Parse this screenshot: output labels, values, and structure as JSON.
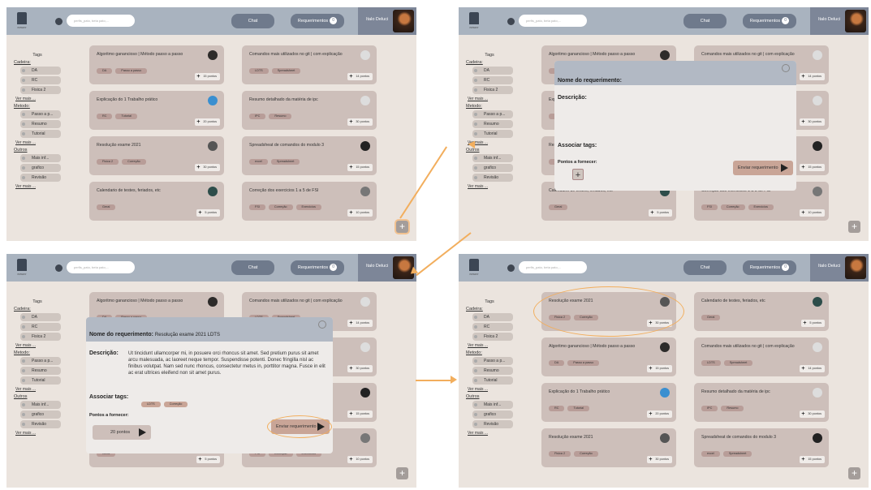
{
  "header": {
    "logo_text": "ISTUDY",
    "search_placeholder": "perfis_pato, beta pato,...",
    "chat": "Chat",
    "requests": "Requerimentos",
    "request_count": "0",
    "user_name": "Italo Deluci"
  },
  "sidebar": {
    "title": "Tags",
    "cadeira_label": "Cadeira:",
    "cadeira_items": [
      "DA",
      "RC",
      "Fisica 2"
    ],
    "metodo_label": "Metodo:",
    "metodo_items": [
      "Passo a p...",
      "Resumo",
      "Tutorial"
    ],
    "outros_label": "Outros",
    "outros_items": [
      "Mais inf...",
      "grafico",
      "Revisão"
    ],
    "more": "Ver mais ..."
  },
  "cards": [
    {
      "title": "Algoritmo ganancioso | Método passo a passo",
      "tags": [
        "DA",
        "Passo a passo"
      ],
      "points": "15 pontos"
    },
    {
      "title": "Comandos mais utilizados no git | com explicação",
      "tags": [
        "LDTS",
        "Spreadsheet"
      ],
      "points": "14 pontos"
    },
    {
      "title": "Explicação do 1 Trabalho prático",
      "tags": [
        "RC",
        "Tutorial"
      ],
      "points": "20 pontos"
    },
    {
      "title": "Resumo detalhado da matéria de ipc",
      "tags": [
        "IPC",
        "Resumo"
      ],
      "points": "30 pontos"
    },
    {
      "title": "Resolução exame 2021",
      "tags": [
        "Fisica 2",
        "Correção"
      ],
      "points": "30 pontos"
    },
    {
      "title": "Spreadsheat de comandos do modulo 3",
      "tags": [
        "excel",
        "Spreadsheet"
      ],
      "points": "15 pontos"
    },
    {
      "title": "Calendario de testes, feriados, etc",
      "tags": [
        "Geral"
      ],
      "points": "5 pontos"
    },
    {
      "title": "Correção dos exercicios 1 a 5 de FSI",
      "tags": [
        "FSI",
        "Correção",
        "Exercicios"
      ],
      "points": "10 pontos"
    }
  ],
  "modal_empty": {
    "name_label": "Nome do requerimento:",
    "desc_label": "Descrição:",
    "tags_label": "Associar tags:",
    "points_label": "Pontos a fornecer:",
    "send": "Enviar requerimento"
  },
  "modal_filled": {
    "name_label": "Nome do requerimento:",
    "name_value": "Resolução exame 2021 LDTS",
    "desc_label": "Descrição:",
    "desc_value": "Ut tincidunt ullamcorper mi, in posuere orci rhoncus sit amet. Sed pretium purus sit amet arcu malesuada, ac laoreet neque tempor. Suspendisse potenti. Donec fringilla nisl ac finibus volutpat. Nam sed nunc rhoncus, consectetur metus in, porttitor magna. Fusce in elit ac erat ultrices eleifend non sit amet purus.",
    "tags_label": "Associar tags:",
    "tags": [
      "LDTS",
      "Correção"
    ],
    "points_label": "Pontos a fornecer:",
    "points_value": "20 pontos",
    "send": "Enviar requerimento"
  },
  "colors": {
    "accent": "#f2ae5d",
    "topbar": "#a9b3bf",
    "card": "#cdbfba",
    "background": "#ebe4de"
  }
}
